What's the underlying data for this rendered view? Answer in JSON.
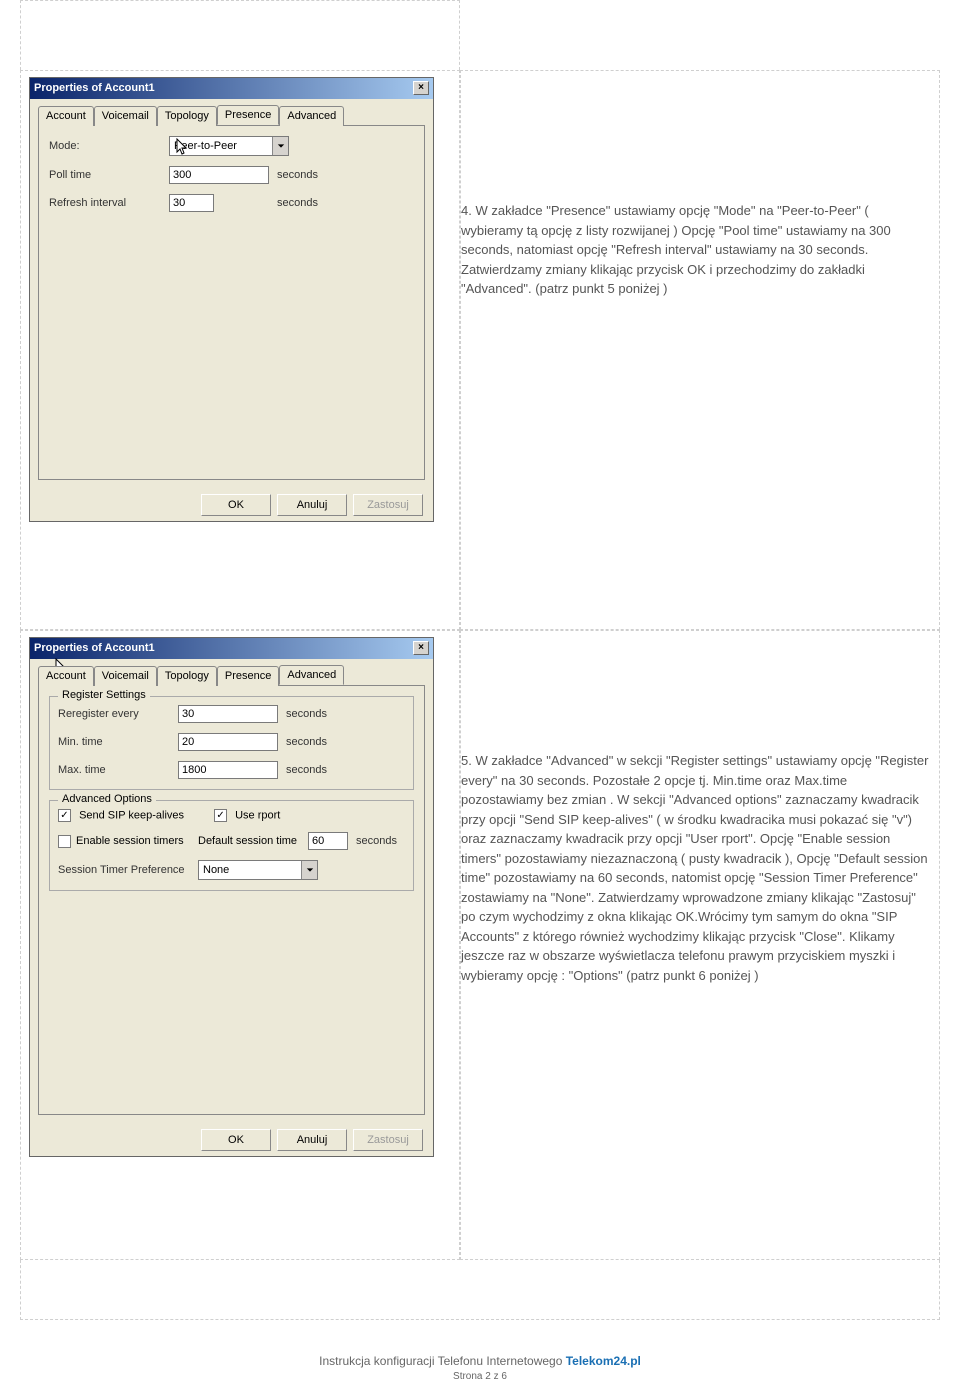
{
  "dialog1": {
    "title": "Properties of Account1",
    "tabs": [
      "Account",
      "Voicemail",
      "Topology",
      "Presence",
      "Advanced"
    ],
    "active_tab": "Presence",
    "mode_label": "Mode:",
    "mode_value": "Peer-to-Peer",
    "poll_label": "Poll time",
    "poll_value": "300",
    "refresh_label": "Refresh interval",
    "refresh_value": "30",
    "seconds": "seconds",
    "ok": "OK",
    "cancel": "Anuluj",
    "apply": "Zastosuj"
  },
  "desc1": "4. W zakładce \"Presence\" ustawiamy opcję \"Mode\" na \"Peer-to-Peer\" ( wybieramy tą opcję z listy rozwijanej ) Opcję \"Pool time\" ustawiamy na 300 seconds, natomiast opcję \"Refresh interval\" ustawiamy na 30 seconds. Zatwierdzamy zmiany klikając przycisk OK i przechodzimy do zakładki \"Advanced\". (patrz punkt 5 poniżej )",
  "dialog2": {
    "title": "Properties of Account1",
    "tabs": [
      "Account",
      "Voicemail",
      "Topology",
      "Presence",
      "Advanced"
    ],
    "active_tab": "Advanced",
    "group_register": "Register Settings",
    "rereg_label": "Reregister every",
    "rereg_value": "30",
    "min_label": "Min. time",
    "min_value": "20",
    "max_label": "Max. time",
    "max_value": "1800",
    "seconds": "seconds",
    "group_adv": "Advanced Options",
    "send_sip": "Send SIP keep-alives",
    "use_rport": "Use rport",
    "enable_timers": "Enable session timers",
    "default_session_label": "Default session time",
    "default_session_value": "60",
    "timer_pref_label": "Session Timer Preference",
    "timer_pref_value": "None",
    "ok": "OK",
    "cancel": "Anuluj",
    "apply": "Zastosuj"
  },
  "desc2": "5. W zakładce \"Advanced\" w sekcji \"Register settings\" ustawiamy opcję \"Register every\" na 30 seconds. Pozostałe 2 opcje tj. Min.time oraz Max.time pozostawiamy bez zmian . W sekcji \"Advanced options\" zaznaczamy kwadracik przy opcji \"Send SIP keep-alives\" ( w środku kwadracika musi pokazać się \"v\") oraz zaznaczamy kwadracik przy opcji \"User rport\". Opcję \"Enable session timers\" pozostawiamy niezaznaczoną ( pusty kwadracik ), Opcję \"Default session time\" pozostawiamy na 60 seconds, natomist opcję \"Session Timer Preference\" zostawiamy na \"None\". Zatwierdzamy wprowadzone zmiany klikając \"Zastosuj\" po czym wychodzimy z okna klikając OK.Wrócimy tym samym do okna \"SIP Accounts\" z którego również wychodzimy klikając przycisk \"Close\". Klikamy jeszcze raz w obszarze wyświetlacza telefonu prawym przyciskiem myszki i wybieramy opcję : \"Options\" (patrz punkt 6 poniżej )",
  "footer": {
    "text": "Instrukcja konfiguracji Telefonu Internetowego",
    "brand": "Telekom24.pl",
    "page": "Strona 2 z 6"
  }
}
